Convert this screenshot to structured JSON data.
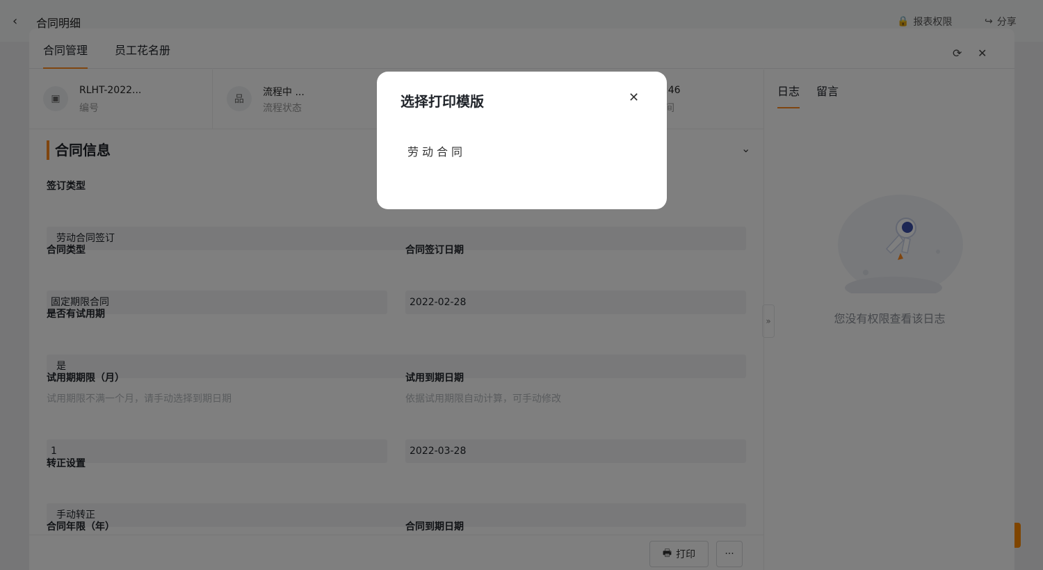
{
  "background_page": {
    "title": "合同明细",
    "back_glyph": "‹",
    "report_perm_label": "报表权限",
    "share_label": "分享"
  },
  "drawer": {
    "tabs": [
      {
        "label": "合同管理",
        "active": true
      },
      {
        "label": "员工花名册",
        "active": false
      }
    ],
    "refresh_glyph": "⟳",
    "close_glyph": "✕",
    "info": [
      {
        "value": "RLHT-2022...",
        "label": "编号",
        "icon": "contract-icon",
        "glyph": "▣"
      },
      {
        "value": "流程中 ...",
        "label": "流程状态",
        "icon": "flow-icon",
        "glyph": "品"
      },
      {
        "value": ":46",
        "label": "间"
      }
    ],
    "section_title": "合同信息",
    "fields": {
      "sign_type": {
        "label": "签订类型",
        "value": "劳动合同签订"
      },
      "contract_type": {
        "label": "合同类型",
        "value": "固定期限合同"
      },
      "sign_date": {
        "label": "合同签订日期",
        "value": "2022-02-28"
      },
      "has_probation": {
        "label": "是否有试用期",
        "value": "是"
      },
      "probation_months": {
        "label": "试用期期限（月）",
        "hint": "试用期限不满一个月，请手动选择到期日期",
        "value": "1"
      },
      "probation_end": {
        "label": "试用到期日期",
        "hint": "依据试用期限自动计算，可手动修改",
        "value": "2022-03-28"
      },
      "regularize": {
        "label": "转正设置",
        "value": "手动转正"
      },
      "contract_years": {
        "label": "合同年限（年）"
      },
      "contract_end": {
        "label": "合同到期日期"
      }
    },
    "footer": {
      "print_label": "打印",
      "more_glyph": "···"
    },
    "right_panel": {
      "tabs": [
        {
          "label": "日志",
          "active": true
        },
        {
          "label": "留言",
          "active": false
        }
      ],
      "empty_text": "您没有权限查看该日志",
      "collapse_glyph": "»"
    }
  },
  "modal": {
    "title": "选择打印模版",
    "close_glyph": "✕",
    "items": [
      "劳动合同"
    ]
  },
  "colors": {
    "accent": "#ff8a1f",
    "overlay": "rgba(0,0,0,0.5)"
  }
}
